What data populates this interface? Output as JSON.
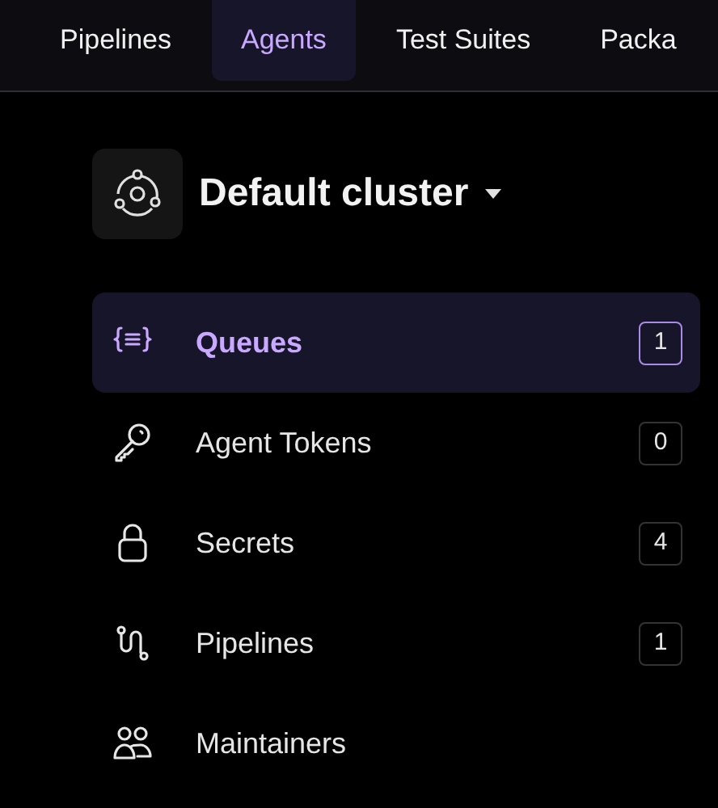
{
  "nav_tabs": [
    {
      "label": "Pipelines",
      "selected": false
    },
    {
      "label": "Agents",
      "selected": true
    },
    {
      "label": "Test Suites",
      "selected": false
    },
    {
      "label": "Packa",
      "selected": false
    }
  ],
  "cluster": {
    "title": "Default cluster"
  },
  "menu_items": [
    {
      "label": "Queues",
      "count": "1",
      "selected": true
    },
    {
      "label": "Agent Tokens",
      "count": "0",
      "selected": false
    },
    {
      "label": "Secrets",
      "count": "4",
      "selected": false
    },
    {
      "label": "Pipelines",
      "count": "1",
      "selected": false
    },
    {
      "label": "Maintainers",
      "selected": false
    }
  ]
}
